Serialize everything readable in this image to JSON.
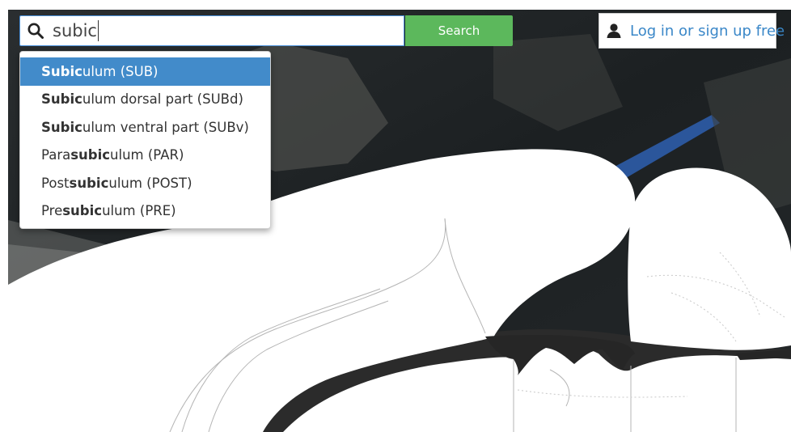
{
  "search": {
    "value": "subic",
    "button_label": "Search"
  },
  "login": {
    "label": "Log in or sign up free"
  },
  "dropdown": {
    "items": [
      {
        "pre": "",
        "match": "Subic",
        "post": "ulum (SUB)",
        "active": true
      },
      {
        "pre": "",
        "match": "Subic",
        "post": "ulum dorsal part (SUBd)",
        "active": false
      },
      {
        "pre": "",
        "match": "Subic",
        "post": "ulum ventral part (SUBv)",
        "active": false
      },
      {
        "pre": "Para",
        "match": "subic",
        "post": "ulum (PAR)",
        "active": false
      },
      {
        "pre": "Post",
        "match": "subic",
        "post": "ulum (POST)",
        "active": false
      },
      {
        "pre": "Pre",
        "match": "subic",
        "post": "ulum (PRE)",
        "active": false
      }
    ]
  },
  "colors": {
    "accent": "#428bca",
    "search_button": "#5cb85c",
    "link": "#3a87c8",
    "background": "#1f2326"
  },
  "icons": {
    "search": "search-icon",
    "user": "user-icon"
  }
}
